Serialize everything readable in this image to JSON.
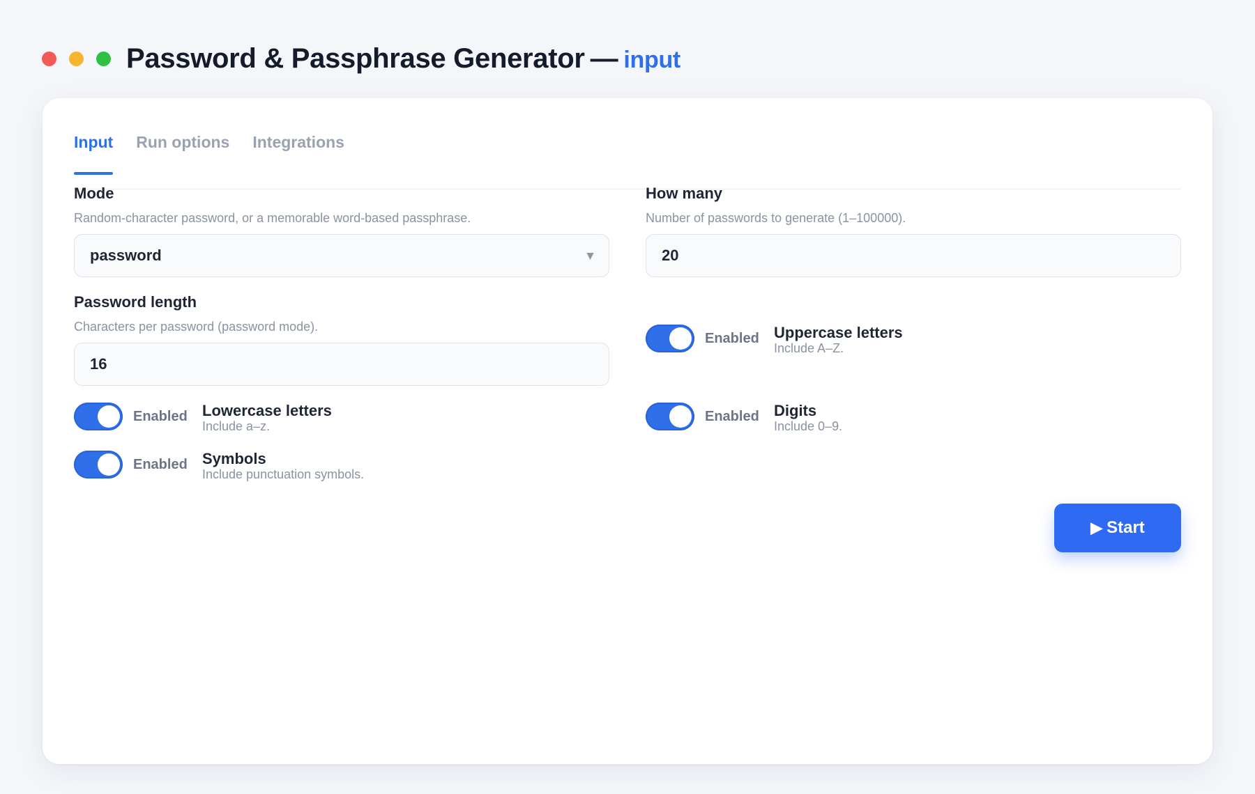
{
  "window": {
    "title": "Password & Passphrase Generator",
    "separator": "—",
    "view": "input"
  },
  "tabs": [
    {
      "label": "Input",
      "active": true
    },
    {
      "label": "Run options",
      "active": false
    },
    {
      "label": "Integrations",
      "active": false
    }
  ],
  "fields": {
    "mode": {
      "label": "Mode",
      "help": "Random-character password, or a memorable word-based passphrase.",
      "value": "password",
      "chevron": "▾"
    },
    "how_many": {
      "label": "How many",
      "help": "Number of passwords to generate (1–100000).",
      "value": "20"
    },
    "password_length": {
      "label": "Password length",
      "help": "Characters per password (password mode).",
      "value": "16"
    }
  },
  "toggles": {
    "uppercase": {
      "state": "Enabled",
      "title": "Uppercase letters",
      "sub": "Include A–Z.",
      "on": true
    },
    "lowercase": {
      "state": "Enabled",
      "title": "Lowercase letters",
      "sub": "Include a–z.",
      "on": true
    },
    "digits": {
      "state": "Enabled",
      "title": "Digits",
      "sub": "Include 0–9.",
      "on": true
    },
    "symbols": {
      "state": "Enabled",
      "title": "Symbols",
      "sub": "Include punctuation symbols.",
      "on": true
    }
  },
  "actions": {
    "start_icon": "▶",
    "start_label": "Start"
  },
  "colors": {
    "accent": "#2f6fea",
    "window_close": "#f25a57",
    "window_minimize": "#f6b52c",
    "window_maximize": "#2fc144"
  }
}
